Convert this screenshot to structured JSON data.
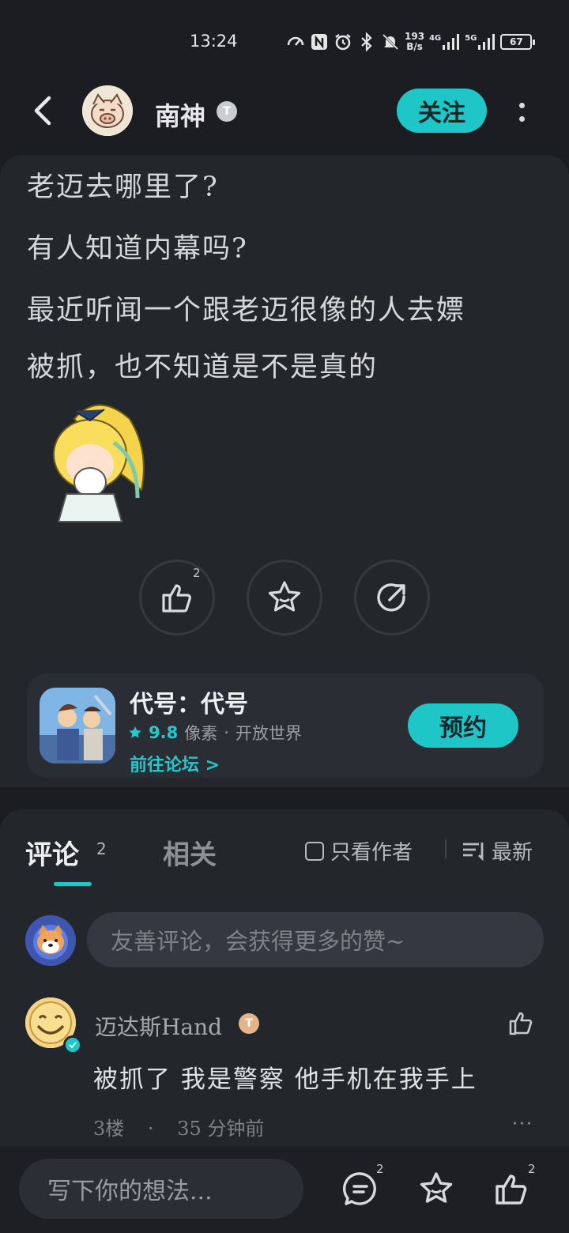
{
  "status_bar": {
    "time": "13:24",
    "net_speed_value": "193",
    "net_speed_unit": "B/s",
    "signal_1": "4G",
    "signal_2": "5G",
    "battery": "67"
  },
  "header": {
    "author_name": "南神",
    "author_badge": "T",
    "follow_label": "关注"
  },
  "post": {
    "lines": [
      "老迈去哪里了?",
      "有人知道内幕吗?",
      "最近听闻一个跟老迈很像的人去嫖",
      "被抓，也不知道是不是真的"
    ],
    "like_count": "2"
  },
  "game_card": {
    "name": "代号：代号",
    "score": "9.8",
    "tag1": "像素",
    "separator": "·",
    "tag2": "开放世界",
    "link": "前往论坛 >",
    "reserve_label": "预约",
    "accent_color": "#1fc6c8"
  },
  "comments": {
    "tab_comment_label": "评论",
    "tab_comment_count": "2",
    "tab_related_label": "相关",
    "only_author_label": "只看作者",
    "sort_label": "最新",
    "input_placeholder": "友善评论，会获得更多的赞~",
    "items": [
      {
        "username": "迈达斯Hand",
        "badge": "T",
        "text": "被抓了 我是警察 他手机在我手上",
        "floor": "3楼",
        "dot": "·",
        "time": "35 分钟前",
        "more": "···"
      }
    ]
  },
  "bottom_bar": {
    "input_placeholder": "写下你的想法...",
    "comment_count": "2",
    "like_count": "2"
  }
}
